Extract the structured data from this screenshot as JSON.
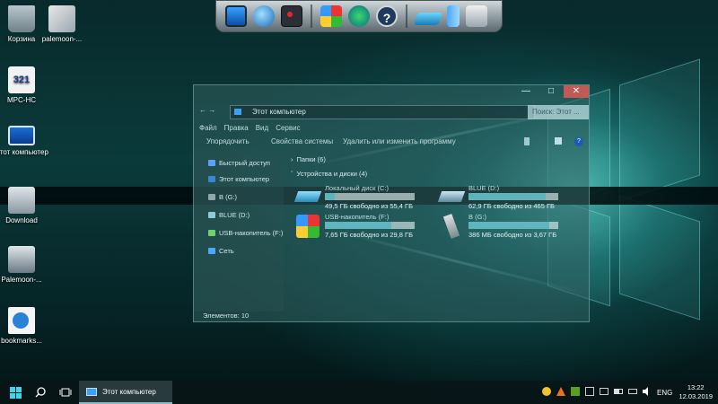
{
  "desktop": {
    "icons": [
      {
        "label": "Корзина"
      },
      {
        "label": "palemoon-..."
      },
      {
        "label": "MPC-HC"
      },
      {
        "label": "Этот компьютер"
      },
      {
        "label": "Download"
      },
      {
        "label": "Palemoon-..."
      },
      {
        "label": "bookmarks..."
      }
    ],
    "mpc_badge": "321"
  },
  "dock": {
    "items": [
      "monitor-icon",
      "network-globe-icon",
      "camera-icon",
      "windows-logo-icon",
      "download-globe-icon",
      "help-icon",
      "usb-drive-icon",
      "battery-icon",
      "app-icon"
    ]
  },
  "explorer": {
    "title_buttons": {
      "min": "—",
      "max": "□",
      "close": "✕"
    },
    "nav_arrows": "← →",
    "address": "Этот компьютер",
    "search_placeholder": "Поиск: Этот ...",
    "menu": [
      "Файл",
      "Правка",
      "Вид",
      "Сервис"
    ],
    "commands": [
      "Упорядочить",
      "Свойства системы",
      "Удалить или изменить программу"
    ],
    "nav_pane": [
      {
        "label": "Быстрый доступ"
      },
      {
        "label": "Этот компьютер"
      },
      {
        "label": "B (G:)"
      },
      {
        "label": "BLUE (D:)"
      },
      {
        "label": "USB-накопитель (F:)"
      },
      {
        "label": "Сеть"
      }
    ],
    "groups": {
      "folders": "Папки (6)",
      "devices": "Устройства и диски (4)"
    },
    "drives": [
      {
        "name": "Локальный диск (C:)",
        "free": "49,5 ГБ свободно из 55,4 ГБ",
        "used_fraction": 0.11
      },
      {
        "name": "BLUE (D:)",
        "free": "62,9 ГБ свободно из 465 ГБ",
        "used_fraction": 0.86
      },
      {
        "name": "USB-накопитель (F:)",
        "free": "7,65 ГБ свободно из 29,8 ГБ",
        "used_fraction": 0.74
      },
      {
        "name": "B (G:)",
        "free": "386 МБ свободно из 3,67 ГБ",
        "used_fraction": 0.9
      }
    ],
    "status": "Элементов: 10"
  },
  "taskbar": {
    "active_app": "Этот компьютер",
    "language": "ENG",
    "time": "13:22",
    "date": "12.03.2019"
  },
  "colors": {
    "accent": "#3fd6d0",
    "close": "#c05a57",
    "taskbar": "#081618"
  }
}
